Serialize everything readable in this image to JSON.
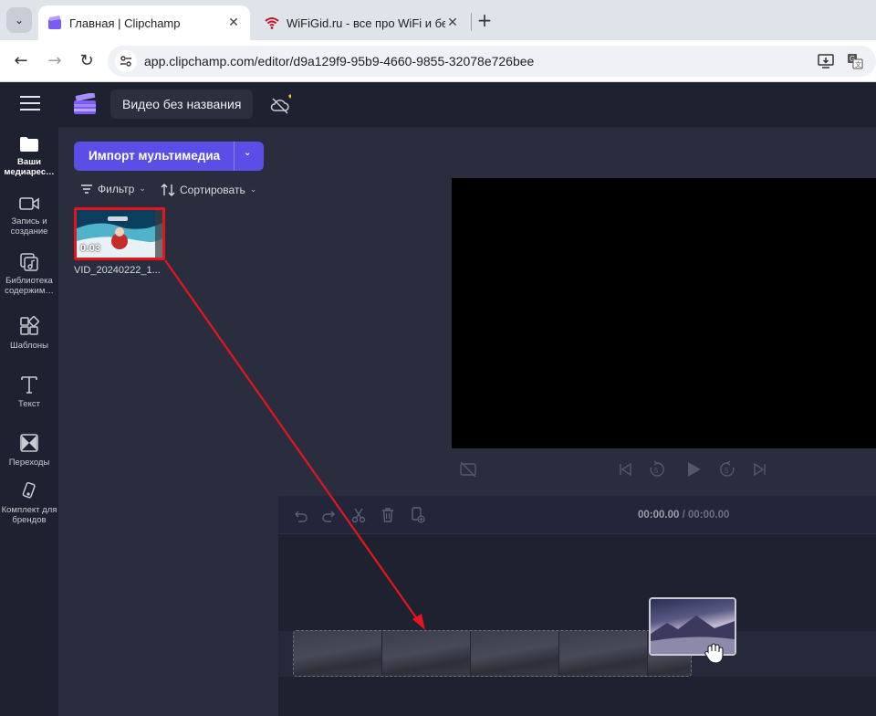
{
  "browser": {
    "tabs": [
      {
        "title": "Главная | Clipchamp",
        "active": true
      },
      {
        "title": "WiFiGid.ru - все про WiFi и бес",
        "active": false
      }
    ],
    "url": "app.clipchamp.com/editor/d9a129f9-95b9-4660-9855-32078e726bee"
  },
  "app": {
    "project_title": "Видео без названия"
  },
  "rail": [
    {
      "label": "Ваши медиарес…",
      "icon": "folder-icon",
      "active": true
    },
    {
      "label": "Запись и создание",
      "icon": "camera-icon",
      "active": false
    },
    {
      "label": "Библиотека содержим…",
      "icon": "library-icon",
      "active": false
    },
    {
      "label": "Шаблоны",
      "icon": "templates-icon",
      "active": false
    },
    {
      "label": "Текст",
      "icon": "text-icon",
      "active": false
    },
    {
      "label": "Переходы",
      "icon": "transitions-icon",
      "active": false
    },
    {
      "label": "Комплект для брендов",
      "icon": "brand-kit-icon",
      "active": false
    }
  ],
  "media": {
    "import_label": "Импорт мультимедиа",
    "filter_label": "Фильтр",
    "sort_label": "Сортировать",
    "items": [
      {
        "filename": "VID_20240222_1...",
        "duration": "0:03"
      }
    ]
  },
  "timeline": {
    "current_time": "00:00.00",
    "separator": " / ",
    "total_time": "00:00.00"
  },
  "colors": {
    "accent": "#5b4ee6",
    "highlight": "#e4161b"
  }
}
